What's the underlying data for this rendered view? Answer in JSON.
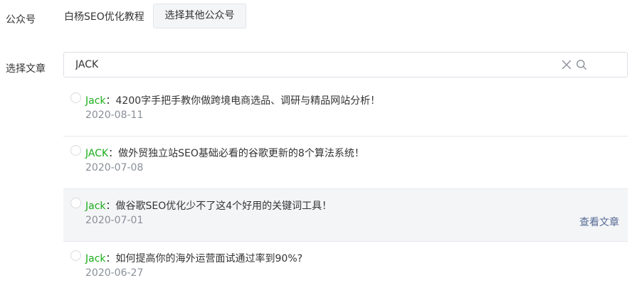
{
  "account": {
    "label": "公众号",
    "name": "白杨SEO优化教程",
    "select_button": "选择其他公众号"
  },
  "article_picker": {
    "label": "选择文章",
    "search_value": "JACK",
    "search_placeholder": "",
    "view_link": "查看文章",
    "articles": [
      {
        "author": "Jack",
        "separator": "：",
        "title": "4200字手把手教你做跨境电商选品、调研与精品网站分析！",
        "date": "2020-08-11"
      },
      {
        "author": "JACK",
        "separator": "：",
        "title": "做外贸独立站SEO基础必看的谷歌更新的8个算法系统！",
        "date": "2020-07-08"
      },
      {
        "author": "Jack",
        "separator": "：",
        "title": "做谷歌SEO优化少不了这4个好用的关键词工具！",
        "date": "2020-07-01"
      },
      {
        "author": "Jack",
        "separator": "：",
        "title": "如何提高你的海外运营面试通过率到90%?",
        "date": "2020-06-27"
      }
    ]
  },
  "colors": {
    "author": "#1aad19",
    "link": "#576b95",
    "hover_background": "#f4f5f7"
  },
  "icons": {
    "clear": "close-icon",
    "search": "search-icon"
  }
}
